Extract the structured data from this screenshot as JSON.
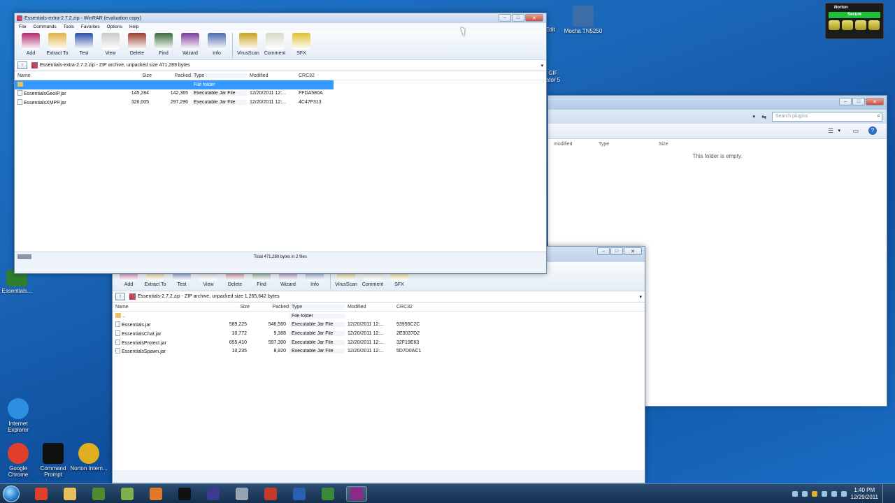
{
  "desktop": {
    "icons": [
      {
        "label": "Mocha TN5250",
        "glyph": "monitor-icon",
        "color": "#3d6da8"
      },
      {
        "label": "Internet Explorer",
        "glyph": "internet-explorer-icon",
        "color": "#2e8fe0"
      },
      {
        "label": "Google Chrome",
        "glyph": "chrome-icon",
        "color": "#e0402b"
      },
      {
        "label": "Command Prompt",
        "glyph": "command-prompt-icon",
        "color": "#111111"
      },
      {
        "label": "Norton Intern...",
        "glyph": "norton-globe-icon",
        "color": "#e0b020"
      },
      {
        "label": "Essentials...",
        "glyph": "folder-icon",
        "color": "#2f7d2f"
      }
    ],
    "partial_labels": [
      "Edit",
      "GIF",
      "ator 5"
    ]
  },
  "norton_widget": {
    "title": "Norton",
    "status": "Secure",
    "status_color": "#1fbe3b"
  },
  "front_window": {
    "title": "Essentials-extra-2.7.2.zip - WinRAR (evaluation copy)",
    "menu": [
      "File",
      "Commands",
      "Tools",
      "Favorites",
      "Options",
      "Help"
    ],
    "toolbar": [
      {
        "label": "Add",
        "icon": "add-books-icon"
      },
      {
        "label": "Extract To",
        "icon": "extract-folder-icon"
      },
      {
        "label": "Test",
        "icon": "test-book-icon"
      },
      {
        "label": "View",
        "icon": "view-glasses-icon"
      },
      {
        "label": "Delete",
        "icon": "delete-icon"
      },
      {
        "label": "Find",
        "icon": "binoculars-icon"
      },
      {
        "label": "Wizard",
        "icon": "wizard-hat-icon"
      },
      {
        "label": "Info",
        "icon": "info-icon"
      },
      {
        "label": "VirusScan",
        "icon": "virus-scan-icon"
      },
      {
        "label": "Comment",
        "icon": "comment-icon"
      },
      {
        "label": "SFX",
        "icon": "sfx-icon"
      }
    ],
    "address": "Essentials-extra-2.7.2.zip - ZIP archive, unpacked size 471,289 bytes",
    "columns": [
      "Name",
      "Size",
      "Packed",
      "Type",
      "Modified",
      "CRC32"
    ],
    "rows": [
      {
        "name": "",
        "size": "",
        "packed": "",
        "type": "File folder",
        "modified": "",
        "crc": "",
        "folder": true,
        "selected": true
      },
      {
        "name": "EssentialsGeoIP.jar",
        "size": "145,284",
        "packed": "142,365",
        "type": "Executable Jar File",
        "modified": "12/20/2011 12:...",
        "crc": "FFDA580A"
      },
      {
        "name": "EssentialsXMPP.jar",
        "size": "326,005",
        "packed": "297,296",
        "type": "Executable Jar File",
        "modified": "12/20/2011 12:...",
        "crc": "4C47F313"
      }
    ],
    "status": "Total 471,289 bytes in 2 files"
  },
  "back_window": {
    "toolbar": [
      {
        "label": "Add",
        "icon": "add-books-icon"
      },
      {
        "label": "Extract To",
        "icon": "extract-folder-icon"
      },
      {
        "label": "Test",
        "icon": "test-book-icon"
      },
      {
        "label": "View",
        "icon": "view-glasses-icon"
      },
      {
        "label": "Delete",
        "icon": "delete-icon"
      },
      {
        "label": "Find",
        "icon": "binoculars-icon"
      },
      {
        "label": "Wizard",
        "icon": "wizard-hat-icon"
      },
      {
        "label": "Info",
        "icon": "info-icon"
      },
      {
        "label": "VirusScan",
        "icon": "virus-scan-icon"
      },
      {
        "label": "Comment",
        "icon": "comment-icon"
      },
      {
        "label": "SFX",
        "icon": "sfx-icon"
      }
    ],
    "address": "Essentials-2.7.2.zip - ZIP archive, unpacked size 1,265,642 bytes",
    "columns": [
      "Name",
      "Size",
      "Packed",
      "Type",
      "Modified",
      "CRC32"
    ],
    "rows": [
      {
        "name": "..",
        "size": "",
        "packed": "",
        "type": "File folder",
        "modified": "",
        "crc": "",
        "folder": true
      },
      {
        "name": "Essentials.jar",
        "size": "589,225",
        "packed": "546,560",
        "type": "Executable Jar File",
        "modified": "12/20/2011 12:...",
        "crc": "93956C2C"
      },
      {
        "name": "EssentialsChat.jar",
        "size": "10,772",
        "packed": "9,388",
        "type": "Executable Jar File",
        "modified": "12/20/2011 12:...",
        "crc": "2E3037D2"
      },
      {
        "name": "EssentialsProtect.jar",
        "size": "655,410",
        "packed": "597,300",
        "type": "Executable Jar File",
        "modified": "12/20/2011 12:...",
        "crc": "32F19E63"
      },
      {
        "name": "EssentialsSpawn.jar",
        "size": "10,235",
        "packed": "8,920",
        "type": "Executable Jar File",
        "modified": "12/20/2011 12:...",
        "crc": "5D7D0AC1"
      }
    ]
  },
  "explorer": {
    "search_placeholder": "Search plugins",
    "columns": [
      "modified",
      "Type",
      "Size"
    ],
    "empty_text": "This folder is empty."
  },
  "taskbar": {
    "buttons": [
      {
        "name": "chrome",
        "icon": "chrome-icon",
        "color": "#e0402b"
      },
      {
        "name": "explorer",
        "icon": "folder-icon",
        "color": "#e6c05a"
      },
      {
        "name": "minecraft",
        "icon": "minecraft-icon",
        "color": "#4f8a2f"
      },
      {
        "name": "notepad",
        "icon": "notepad-icon",
        "color": "#7fb04a"
      },
      {
        "name": "media",
        "icon": "media-player-icon",
        "color": "#e07a2b"
      },
      {
        "name": "cmd",
        "icon": "command-prompt-icon",
        "color": "#111111"
      },
      {
        "name": "eclipse",
        "icon": "eclipse-icon",
        "color": "#3a3a8f"
      },
      {
        "name": "paint",
        "icon": "paint-icon",
        "color": "#9aa4b0"
      },
      {
        "name": "filezilla",
        "icon": "filezilla-icon",
        "color": "#c33a2a"
      },
      {
        "name": "word",
        "icon": "word-icon",
        "color": "#2b5fb4"
      },
      {
        "name": "app",
        "icon": "app-icon",
        "color": "#3b8a3b"
      },
      {
        "name": "winrar",
        "icon": "winrar-icon",
        "color": "#8a2a8a"
      }
    ],
    "time": "1:40 PM",
    "date": "12/29/2011"
  }
}
